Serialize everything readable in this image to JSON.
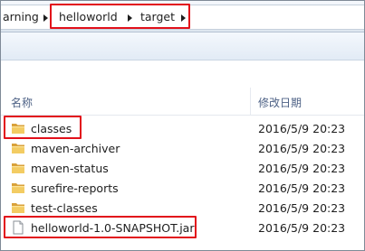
{
  "address_bar": {
    "crumbs": [
      "arning",
      "helloworld",
      "target"
    ]
  },
  "columns": {
    "name": "名称",
    "modified": "修改日期"
  },
  "files": [
    {
      "name": "classes",
      "date": "2016/5/9 20:23",
      "type": "folder"
    },
    {
      "name": "maven-archiver",
      "date": "2016/5/9 20:23",
      "type": "folder"
    },
    {
      "name": "maven-status",
      "date": "2016/5/9 20:23",
      "type": "folder"
    },
    {
      "name": "surefire-reports",
      "date": "2016/5/9 20:23",
      "type": "folder"
    },
    {
      "name": "test-classes",
      "date": "2016/5/9 20:23",
      "type": "folder"
    },
    {
      "name": "helloworld-1.0-SNAPSHOT.jar",
      "date": "2016/5/9 20:23",
      "type": "file"
    }
  ],
  "colors": {
    "highlight": "#e2101a",
    "header_text": "#4d6185",
    "folder": "#e8b84a"
  }
}
